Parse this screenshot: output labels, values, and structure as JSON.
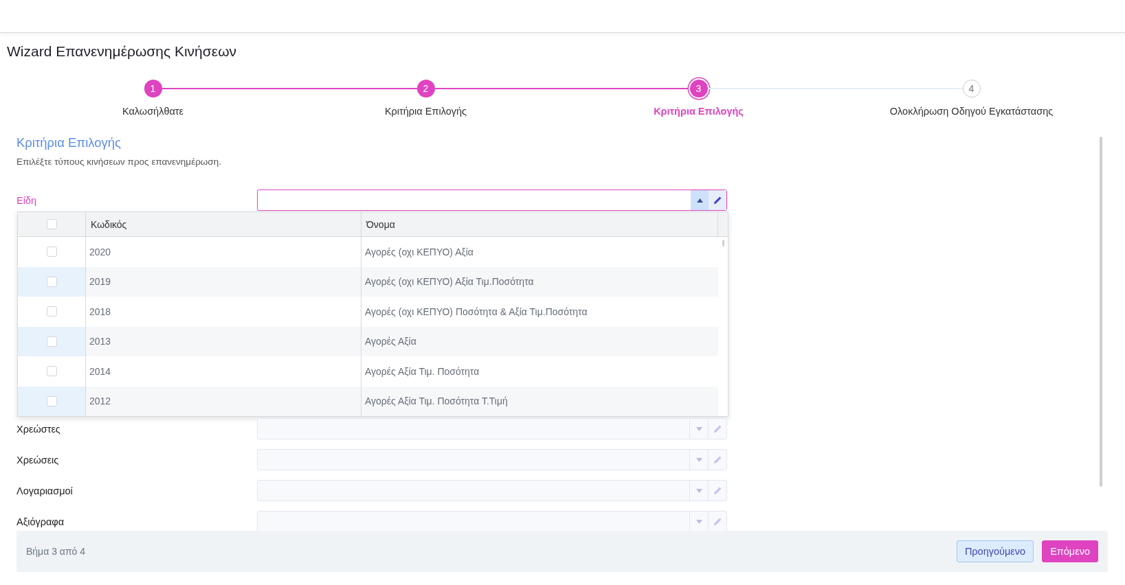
{
  "title": "Wizard Επανενημέρωσης Κινήσεων",
  "steps": [
    {
      "number": "1",
      "label": "Καλωσήλθατε",
      "kind": "done"
    },
    {
      "number": "2",
      "label": "Κριτήρια Επιλογής",
      "kind": "done"
    },
    {
      "number": "3",
      "label": "Κριτήρια Επιλογής",
      "kind": "current"
    },
    {
      "number": "4",
      "label": "Ολοκλήρωση Οδηγού Εγκατάστασης",
      "kind": "pending"
    }
  ],
  "section": {
    "heading": "Κριτήρια Επιλογής",
    "description": "Επιλέξτε τύπους κινήσεων προς επανενημέρωση."
  },
  "fields": [
    {
      "label": "Είδη",
      "open": true
    },
    {
      "label": "Χρεώστες",
      "open": false
    },
    {
      "label": "Χρεώσεις",
      "open": false
    },
    {
      "label": "Λογαριασμοί",
      "open": false
    },
    {
      "label": "Αξιόγραφα",
      "open": false
    }
  ],
  "dropdown": {
    "all_checked": false,
    "columns": [
      "Κωδικός",
      "Όνομα"
    ],
    "rows": [
      {
        "code": "2020",
        "name": "Αγορές (οχι ΚΕΠΥΟ) Αξία",
        "checked": false
      },
      {
        "code": "2019",
        "name": "Αγορές (οχι ΚΕΠΥΟ) Αξία Τιμ.Ποσότητα",
        "checked": false
      },
      {
        "code": "2018",
        "name": "Αγορές (οχι ΚΕΠΥΟ) Ποσότητα & Αξία Τιμ.Ποσότητα",
        "checked": false
      },
      {
        "code": "2013",
        "name": "Αγορές Αξία",
        "checked": false
      },
      {
        "code": "2014",
        "name": "Αγορές Αξία Τιμ. Ποσότητα",
        "checked": false
      },
      {
        "code": "2012",
        "name": "Αγορές Αξία Τιμ. Ποσότητα Τ.Τιμή",
        "checked": false
      }
    ]
  },
  "footer": {
    "step_text": "Βήμα 3 από 4",
    "buttons": [
      {
        "label": "Προηγούμενο",
        "kind": "secondary"
      },
      {
        "label": "Επόμενο",
        "kind": "primary"
      }
    ]
  }
}
